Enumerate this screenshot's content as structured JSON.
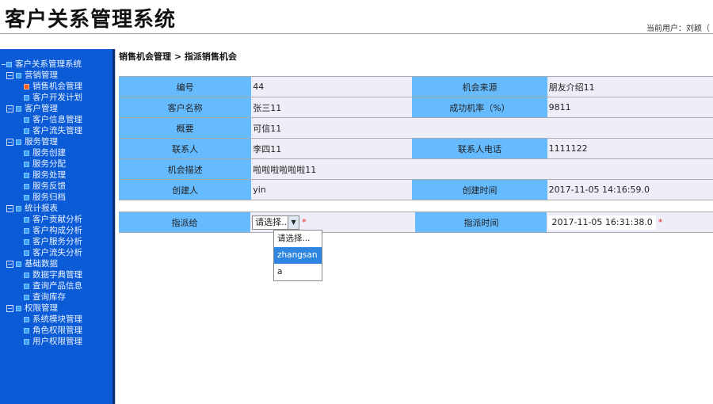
{
  "header": {
    "title": "客户关系管理系统",
    "current_user": "当前用户：刘颖（"
  },
  "sidebar": {
    "items": [
      {
        "label": "客户关系管理系统",
        "level": 0
      },
      {
        "label": "营销管理",
        "level": 1
      },
      {
        "label": "销售机会管理",
        "level": 2,
        "selected": true
      },
      {
        "label": "客户开发计划",
        "level": 2
      },
      {
        "label": "客户管理",
        "level": 1
      },
      {
        "label": "客户信息管理",
        "level": 2
      },
      {
        "label": "客户流失管理",
        "level": 2
      },
      {
        "label": "服务管理",
        "level": 1
      },
      {
        "label": "服务创建",
        "level": 2
      },
      {
        "label": "服务分配",
        "level": 2
      },
      {
        "label": "服务处理",
        "level": 2
      },
      {
        "label": "服务反馈",
        "level": 2
      },
      {
        "label": "服务归档",
        "level": 2
      },
      {
        "label": "统计报表",
        "level": 1
      },
      {
        "label": "客户贡献分析",
        "level": 2
      },
      {
        "label": "客户构成分析",
        "level": 2
      },
      {
        "label": "客户服务分析",
        "level": 2
      },
      {
        "label": "客户流失分析",
        "level": 2
      },
      {
        "label": "基础数据",
        "level": 1
      },
      {
        "label": "数据字典管理",
        "level": 2
      },
      {
        "label": "查询产品信息",
        "level": 2
      },
      {
        "label": "查询库存",
        "level": 2
      },
      {
        "label": "权限管理",
        "level": 1
      },
      {
        "label": "系统模块管理",
        "level": 2
      },
      {
        "label": "角色权限管理",
        "level": 2
      },
      {
        "label": "用户权限管理",
        "level": 2
      }
    ]
  },
  "breadcrumb": "销售机会管理  > 指派销售机会",
  "detail": {
    "id_label": "编号",
    "id": "44",
    "source_label": "机会来源",
    "source": "朋友介绍11",
    "customer_label": "客户名称",
    "customer": "张三11",
    "rate_label": "成功机率（%）",
    "rate": "9811",
    "summary_label": "概要",
    "summary": "可信11",
    "contact_label": "联系人",
    "contact": "李四11",
    "phone_label": "联系人电话",
    "phone": "1111122",
    "desc_label": "机会描述",
    "desc": "啦啦啦啦啦啦11",
    "creator_label": "创建人",
    "creator": "yin",
    "created_label": "创建时间",
    "created": "2017-11-05 14:16:59.0"
  },
  "assign": {
    "to_label": "指派给",
    "selected": "请选择...",
    "options": [
      "请选择...",
      "zhangsan",
      "a"
    ],
    "highlighted": "zhangsan",
    "time_label": "指派时间",
    "time": "2017-11-05 16:31:38.0",
    "required_mark": "*"
  }
}
